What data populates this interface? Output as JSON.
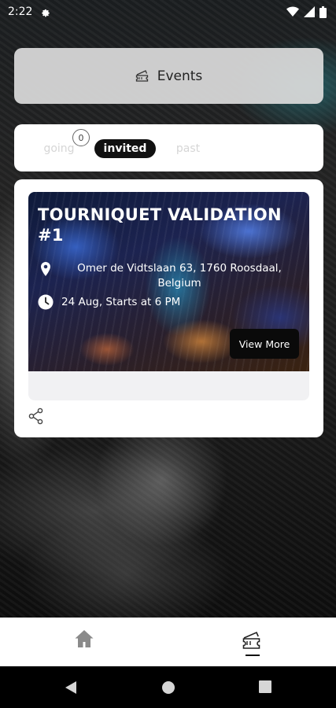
{
  "status_bar": {
    "time": "2:22"
  },
  "header": {
    "title": "Events"
  },
  "tabs": [
    {
      "label": "going",
      "badge": "0"
    },
    {
      "label": "invited"
    },
    {
      "label": "past"
    }
  ],
  "events": [
    {
      "title": "TOURNIQUET VALIDATION #1",
      "location": "Omer de Vidtslaan 63, 1760 Roosdaal, Belgium",
      "date": "24 Aug, Starts at 6 PM",
      "button_label": "View More"
    }
  ],
  "colors": {
    "accent": "#111111",
    "card": "#ffffff",
    "tab_inactive": "#d6d6d6"
  },
  "icons": [
    "settings-gear-icon",
    "wifi-icon",
    "signal-icon",
    "battery-icon",
    "ticket-icon",
    "location-pin-icon",
    "clock-icon",
    "share-icon",
    "home-icon"
  ]
}
